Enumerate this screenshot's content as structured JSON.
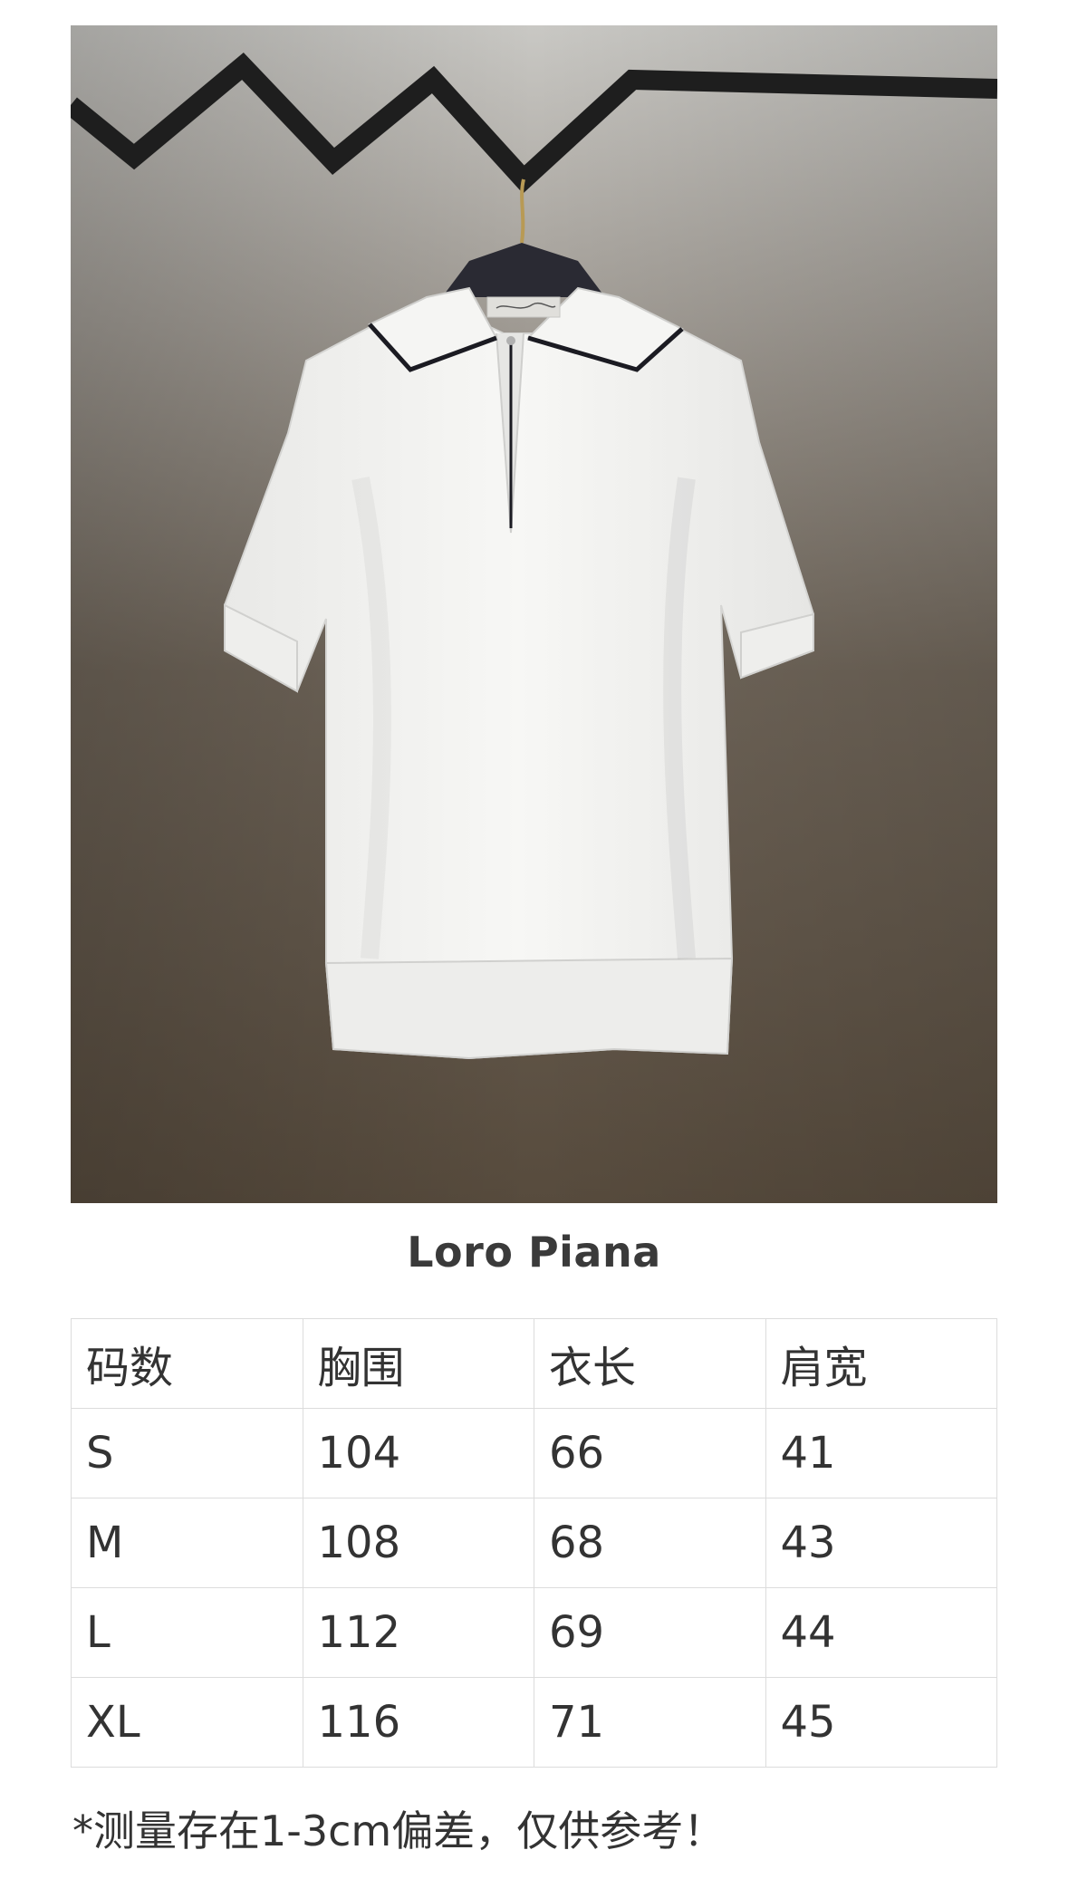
{
  "brand": "Loro Piana",
  "size_table": {
    "header": [
      "码数",
      "胸围",
      "衣长",
      "肩宽"
    ],
    "rows": [
      [
        "S",
        "104",
        "66",
        "41"
      ],
      [
        "M",
        "108",
        "68",
        "43"
      ],
      [
        "L",
        "112",
        "69",
        "44"
      ],
      [
        "XL",
        "116",
        "71",
        "45"
      ]
    ]
  },
  "note": "*测量存在1-3cm偏差，仅供参考！",
  "colors": {
    "shirt": "#f4f4f2",
    "collar_trim": "#1b1b22",
    "background_top": "#c8c6c2",
    "background_bottom": "#5e5244",
    "table_border": "#dcdcdc"
  }
}
